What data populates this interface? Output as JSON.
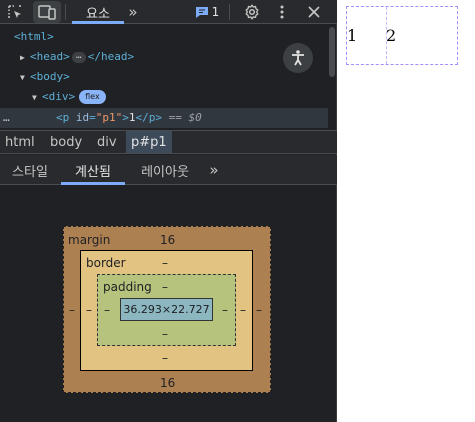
{
  "toolbar": {
    "elements_tab": "요소",
    "more_tabs": "»",
    "issues_count": "1"
  },
  "dom_tree": {
    "html_open": "<html>",
    "head_line": {
      "open": "<head>",
      "ellipsis": "…",
      "close": "</head>"
    },
    "body_open": "<body>",
    "div_open": "<div>",
    "div_badge": "flex",
    "p_open_prefix": "<p ",
    "p_attr_name": "id",
    "p_attr_eq": "=",
    "p_attr_value": "\"p1\"",
    "p_tag_end": ">",
    "p_text": "1",
    "p_close": "</p>",
    "dollar_ref": "== $0"
  },
  "breadcrumbs": [
    "html",
    "body",
    "div",
    "p#p1"
  ],
  "subtabs": {
    "styles": "스타일",
    "computed": "계산됨",
    "layout": "레이아웃",
    "more": "»"
  },
  "box_model": {
    "margin_label": "margin",
    "margin_top": "16",
    "margin_bottom": "16",
    "margin_left": "–",
    "margin_right": "–",
    "border_label": "border",
    "border_top": "–",
    "border_bottom": "–",
    "border_left": "–",
    "border_right": "–",
    "padding_label": "padding",
    "padding_top": "–",
    "padding_bottom": "–",
    "padding_left": "–",
    "padding_right": "–",
    "content_size": "36.293×22.727"
  },
  "page_preview": {
    "item_1": "1",
    "item_2": "2"
  },
  "colors": {
    "accent": "#7cacf8",
    "margin": "#ad8052",
    "border": "#e3c381",
    "padding": "#b6c37d",
    "content": "#8cb6c0"
  }
}
